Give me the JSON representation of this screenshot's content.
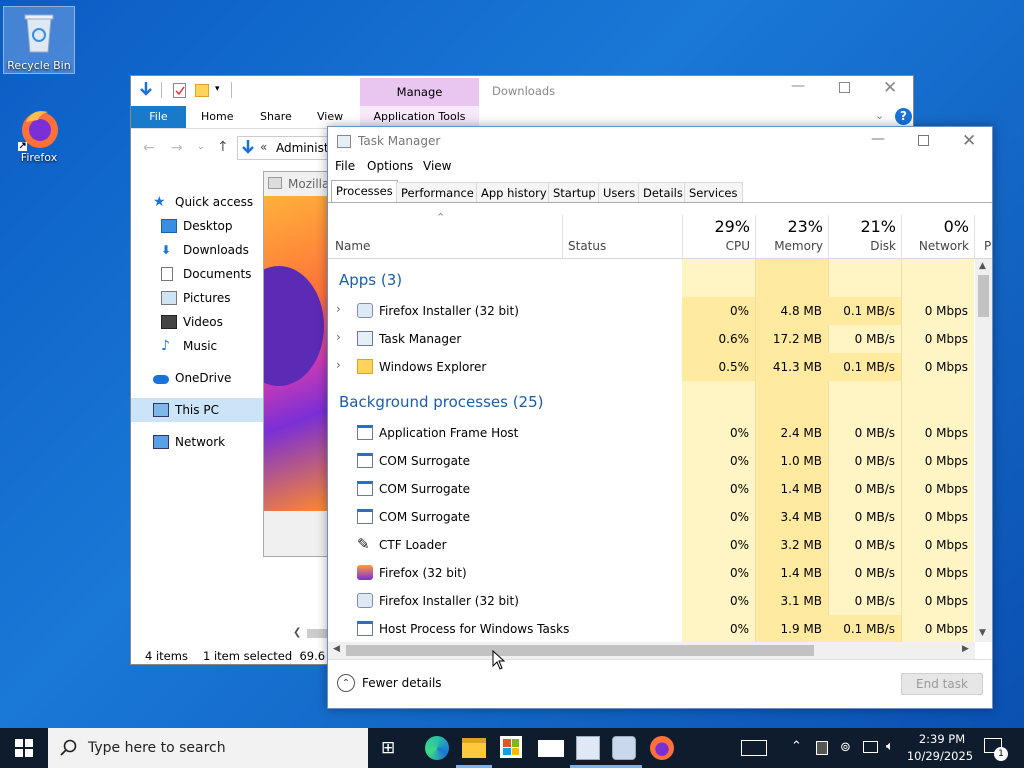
{
  "desktop": {
    "icons": [
      {
        "label": "Recycle Bin"
      },
      {
        "label": "Firefox"
      }
    ]
  },
  "explorer": {
    "context_tab": "Manage",
    "title": "Downloads",
    "tabs": [
      "File",
      "Home",
      "Share",
      "View",
      "Application Tools"
    ],
    "address": "Administ",
    "address_prefix": "«",
    "nav": [
      "Quick access",
      "Desktop",
      "Downloads",
      "Documents",
      "Pictures",
      "Videos",
      "Music",
      "OneDrive",
      "This PC",
      "Network"
    ],
    "status_items": "4 items",
    "status_selected": "1 item selected  69.6 MB",
    "mozilla_title": "Mozilla"
  },
  "tm": {
    "title": "Task Manager",
    "menu": [
      "File",
      "Options",
      "View"
    ],
    "tabs": [
      "Processes",
      "Performance",
      "App history",
      "Startup",
      "Users",
      "Details",
      "Services"
    ],
    "headers": {
      "name": "Name",
      "status": "Status",
      "cpu_pct": "29%",
      "cpu": "CPU",
      "mem_pct": "23%",
      "mem": "Memory",
      "disk_pct": "21%",
      "disk": "Disk",
      "net_pct": "0%",
      "net": "Network",
      "extra": "P"
    },
    "groups": {
      "apps": "Apps (3)",
      "bg": "Background processes (25)"
    },
    "apps": [
      {
        "name": "Firefox Installer (32 bit)",
        "cpu": "0%",
        "mem": "4.8 MB",
        "disk": "0.1 MB/s",
        "net": "0 Mbps"
      },
      {
        "name": "Task Manager",
        "cpu": "0.6%",
        "mem": "17.2 MB",
        "disk": "0 MB/s",
        "net": "0 Mbps"
      },
      {
        "name": "Windows Explorer",
        "cpu": "0.5%",
        "mem": "41.3 MB",
        "disk": "0.1 MB/s",
        "net": "0 Mbps"
      }
    ],
    "bg": [
      {
        "name": "Application Frame Host",
        "cpu": "0%",
        "mem": "2.4 MB",
        "disk": "0 MB/s",
        "net": "0 Mbps"
      },
      {
        "name": "COM Surrogate",
        "cpu": "0%",
        "mem": "1.0 MB",
        "disk": "0 MB/s",
        "net": "0 Mbps"
      },
      {
        "name": "COM Surrogate",
        "cpu": "0%",
        "mem": "1.4 MB",
        "disk": "0 MB/s",
        "net": "0 Mbps"
      },
      {
        "name": "COM Surrogate",
        "cpu": "0%",
        "mem": "3.4 MB",
        "disk": "0 MB/s",
        "net": "0 Mbps"
      },
      {
        "name": "CTF Loader",
        "cpu": "0%",
        "mem": "3.2 MB",
        "disk": "0 MB/s",
        "net": "0 Mbps"
      },
      {
        "name": "Firefox (32 bit)",
        "cpu": "0%",
        "mem": "1.4 MB",
        "disk": "0 MB/s",
        "net": "0 Mbps"
      },
      {
        "name": "Firefox Installer (32 bit)",
        "cpu": "0%",
        "mem": "3.1 MB",
        "disk": "0 MB/s",
        "net": "0 Mbps"
      },
      {
        "name": "Host Process for Windows Tasks",
        "cpu": "0%",
        "mem": "1.9 MB",
        "disk": "0.1 MB/s",
        "net": "0 Mbps"
      }
    ],
    "fewer_details": "Fewer details",
    "end_task": "End task"
  },
  "taskbar": {
    "search_placeholder": "Type here to search",
    "time": "2:39 PM",
    "date": "10/29/2025",
    "notif_count": "1"
  },
  "colors": {
    "heat_light": "#fff4c4",
    "heat_mid": "#ffeaa0",
    "accent": "#0078d7",
    "ribbon_ctx": "#e8c6f0"
  }
}
